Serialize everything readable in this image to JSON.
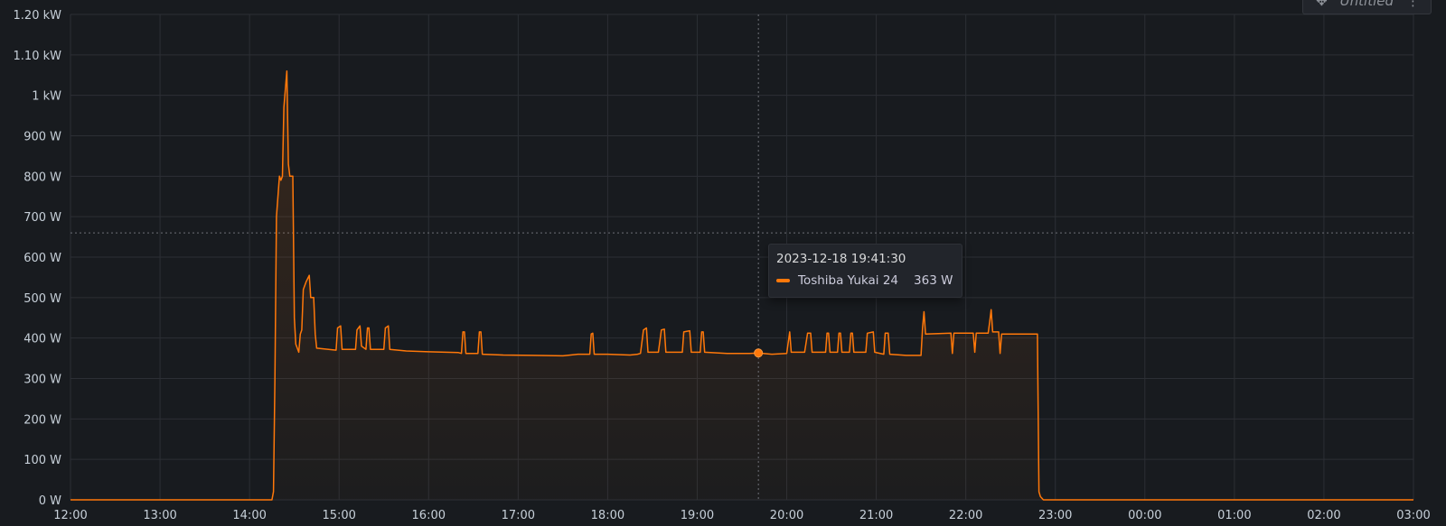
{
  "panel": {
    "title": "Untitled"
  },
  "colors": {
    "series": "#ff780a",
    "background": "#181b1f",
    "grid": "#2c2f35"
  },
  "icons": {
    "move": "move-arrows-icon",
    "menu": "kebab-menu-icon"
  },
  "tooltip": {
    "time": "2023-12-18 19:41:30",
    "series_name": "Toshiba Yukai 24",
    "value_text": "363 W"
  },
  "threshold": {
    "value": 660
  },
  "chart_data": {
    "type": "area",
    "title": "",
    "xlabel": "",
    "ylabel": "",
    "grid": true,
    "legend": "none",
    "ylim": [
      0,
      1200
    ],
    "xlim": [
      "12:00",
      "03:00"
    ],
    "y_ticks": [
      "0 W",
      "100 W",
      "200 W",
      "300 W",
      "400 W",
      "500 W",
      "600 W",
      "700 W",
      "800 W",
      "900 W",
      "1 kW",
      "1.10 kW",
      "1.20 kW"
    ],
    "x_ticks": [
      "12:00",
      "13:00",
      "14:00",
      "15:00",
      "16:00",
      "17:00",
      "18:00",
      "19:00",
      "20:00",
      "21:00",
      "22:00",
      "23:00",
      "00:00",
      "01:00",
      "02:00",
      "03:00"
    ],
    "series": [
      {
        "name": "Toshiba Yukai 24",
        "color": "#ff780a",
        "points": [
          [
            "12:00",
            0
          ],
          [
            "14:15",
            0
          ],
          [
            "14:16",
            20
          ],
          [
            "14:17",
            300
          ],
          [
            "14:18",
            700
          ],
          [
            "14:20",
            800
          ],
          [
            "14:21",
            790
          ],
          [
            "14:22",
            800
          ],
          [
            "14:23",
            970
          ],
          [
            "14:25",
            1060
          ],
          [
            "14:26",
            830
          ],
          [
            "14:27",
            800
          ],
          [
            "14:28",
            800
          ],
          [
            "14:29",
            800
          ],
          [
            "14:30",
            450
          ],
          [
            "14:31",
            385
          ],
          [
            "14:33",
            365
          ],
          [
            "14:34",
            410
          ],
          [
            "14:35",
            420
          ],
          [
            "14:36",
            520
          ],
          [
            "14:38",
            540
          ],
          [
            "14:40",
            555
          ],
          [
            "14:41",
            500
          ],
          [
            "14:43",
            500
          ],
          [
            "14:44",
            410
          ],
          [
            "14:45",
            375
          ],
          [
            "14:58",
            370
          ],
          [
            "14:59",
            425
          ],
          [
            "15:01",
            430
          ],
          [
            "15:02",
            372
          ],
          [
            "15:11",
            372
          ],
          [
            "15:12",
            420
          ],
          [
            "15:14",
            430
          ],
          [
            "15:15",
            380
          ],
          [
            "15:18",
            372
          ],
          [
            "15:19",
            425
          ],
          [
            "15:20",
            425
          ],
          [
            "15:21",
            372
          ],
          [
            "15:30",
            372
          ],
          [
            "15:31",
            425
          ],
          [
            "15:33",
            430
          ],
          [
            "15:34",
            372
          ],
          [
            "15:45",
            368
          ],
          [
            "16:00",
            366
          ],
          [
            "16:20",
            364
          ],
          [
            "16:22",
            362
          ],
          [
            "16:23",
            415
          ],
          [
            "16:24",
            415
          ],
          [
            "16:25",
            362
          ],
          [
            "16:33",
            362
          ],
          [
            "16:34",
            415
          ],
          [
            "16:35",
            415
          ],
          [
            "16:36",
            360
          ],
          [
            "16:50",
            358
          ],
          [
            "17:10",
            357
          ],
          [
            "17:30",
            356
          ],
          [
            "17:40",
            360
          ],
          [
            "17:48",
            360
          ],
          [
            "17:49",
            410
          ],
          [
            "17:50",
            412
          ],
          [
            "17:51",
            360
          ],
          [
            "18:00",
            360
          ],
          [
            "18:15",
            358
          ],
          [
            "18:20",
            360
          ],
          [
            "18:22",
            362
          ],
          [
            "18:24",
            420
          ],
          [
            "18:26",
            425
          ],
          [
            "18:27",
            365
          ],
          [
            "18:34",
            365
          ],
          [
            "18:36",
            420
          ],
          [
            "18:38",
            422
          ],
          [
            "18:39",
            365
          ],
          [
            "18:50",
            365
          ],
          [
            "18:51",
            415
          ],
          [
            "18:55",
            418
          ],
          [
            "18:56",
            365
          ],
          [
            "19:02",
            365
          ],
          [
            "19:03",
            415
          ],
          [
            "19:04",
            415
          ],
          [
            "19:05",
            365
          ],
          [
            "19:20",
            362
          ],
          [
            "19:35",
            362
          ],
          [
            "19:41",
            363
          ],
          [
            "19:50",
            360
          ],
          [
            "20:00",
            362
          ],
          [
            "20:02",
            415
          ],
          [
            "20:03",
            365
          ],
          [
            "20:12",
            365
          ],
          [
            "20:14",
            412
          ],
          [
            "20:16",
            412
          ],
          [
            "20:17",
            365
          ],
          [
            "20:26",
            365
          ],
          [
            "20:27",
            412
          ],
          [
            "20:28",
            412
          ],
          [
            "20:29",
            365
          ],
          [
            "20:34",
            365
          ],
          [
            "20:35",
            412
          ],
          [
            "20:36",
            412
          ],
          [
            "20:37",
            365
          ],
          [
            "20:42",
            365
          ],
          [
            "20:43",
            412
          ],
          [
            "20:44",
            412
          ],
          [
            "20:45",
            365
          ],
          [
            "20:53",
            365
          ],
          [
            "20:54",
            412
          ],
          [
            "20:58",
            415
          ],
          [
            "20:59",
            365
          ],
          [
            "21:05",
            360
          ],
          [
            "21:06",
            412
          ],
          [
            "21:08",
            412
          ],
          [
            "21:09",
            360
          ],
          [
            "21:20",
            357
          ],
          [
            "21:30",
            357
          ],
          [
            "21:31",
            425
          ],
          [
            "21:32",
            465
          ],
          [
            "21:33",
            410
          ],
          [
            "21:50",
            412
          ],
          [
            "21:51",
            362
          ],
          [
            "21:52",
            412
          ],
          [
            "22:05",
            412
          ],
          [
            "22:06",
            365
          ],
          [
            "22:07",
            412
          ],
          [
            "22:15",
            412
          ],
          [
            "22:16",
            440
          ],
          [
            "22:17",
            470
          ],
          [
            "22:18",
            415
          ],
          [
            "22:22",
            415
          ],
          [
            "22:23",
            362
          ],
          [
            "22:24",
            410
          ],
          [
            "22:35",
            410
          ],
          [
            "22:48",
            410
          ],
          [
            "22:49",
            20
          ],
          [
            "22:50",
            8
          ],
          [
            "22:52",
            0
          ],
          [
            "03:00",
            0
          ]
        ]
      }
    ]
  }
}
